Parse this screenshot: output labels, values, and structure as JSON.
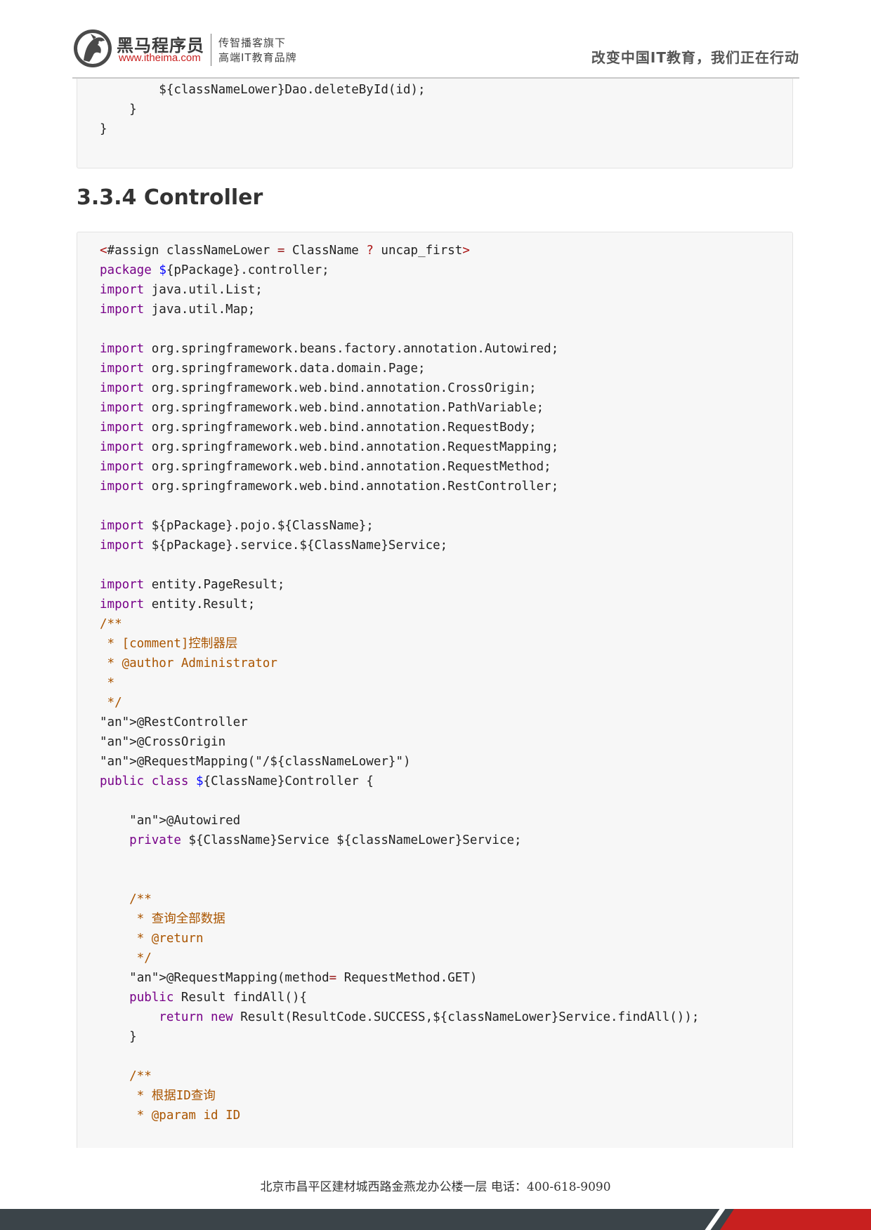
{
  "header": {
    "brand_name": "黑马程序员",
    "brand_url": "www.itheima.com",
    "slogan_line1": "传智播客旗下",
    "slogan_line2": "高端IT教育品牌",
    "motto": "改变中国IT教育，我们正在行动",
    "logo_icon": "horse-head-logo"
  },
  "code_top": {
    "lines": [
      "        ${classNameLower}Dao.deleteById(id);",
      "    }",
      "}"
    ]
  },
  "section": {
    "title": "3.3.4 Controller"
  },
  "code_main": {
    "lines": [
      "<#assign classNameLower = ClassName ? uncap_first>",
      "package ${pPackage}.controller;",
      "import java.util.List;",
      "import java.util.Map;",
      "",
      "import org.springframework.beans.factory.annotation.Autowired;",
      "import org.springframework.data.domain.Page;",
      "import org.springframework.web.bind.annotation.CrossOrigin;",
      "import org.springframework.web.bind.annotation.PathVariable;",
      "import org.springframework.web.bind.annotation.RequestBody;",
      "import org.springframework.web.bind.annotation.RequestMapping;",
      "import org.springframework.web.bind.annotation.RequestMethod;",
      "import org.springframework.web.bind.annotation.RestController;",
      "",
      "import ${pPackage}.pojo.${ClassName};",
      "import ${pPackage}.service.${ClassName}Service;",
      "",
      "import entity.PageResult;",
      "import entity.Result;",
      "/**",
      " * [comment]控制器层",
      " * @author Administrator",
      " *",
      " */",
      "@RestController",
      "@CrossOrigin",
      "@RequestMapping(\"/${classNameLower}\")",
      "public class ${ClassName}Controller {",
      "",
      "    @Autowired",
      "    private ${ClassName}Service ${classNameLower}Service;",
      "",
      "",
      "    /**",
      "     * 查询全部数据",
      "     * @return",
      "     */",
      "    @RequestMapping(method= RequestMethod.GET)",
      "    public Result findAll(){",
      "        return new Result(ResultCode.SUCCESS,${classNameLower}Service.findAll());",
      "    }",
      "",
      "    /**",
      "     * 根据ID查询",
      "     * @param id ID"
    ]
  },
  "footer": {
    "address": "北京市昌平区建材城西路金燕龙办公楼一层    电话：400-618-9090"
  },
  "colors": {
    "brand_red": "#c8201f",
    "footer_bar": "#3b4449",
    "code_bg": "#f7f7f7",
    "keyword": "#770088",
    "comment": "#aa5500",
    "string": "#aa1111",
    "annotation": "#555555"
  }
}
